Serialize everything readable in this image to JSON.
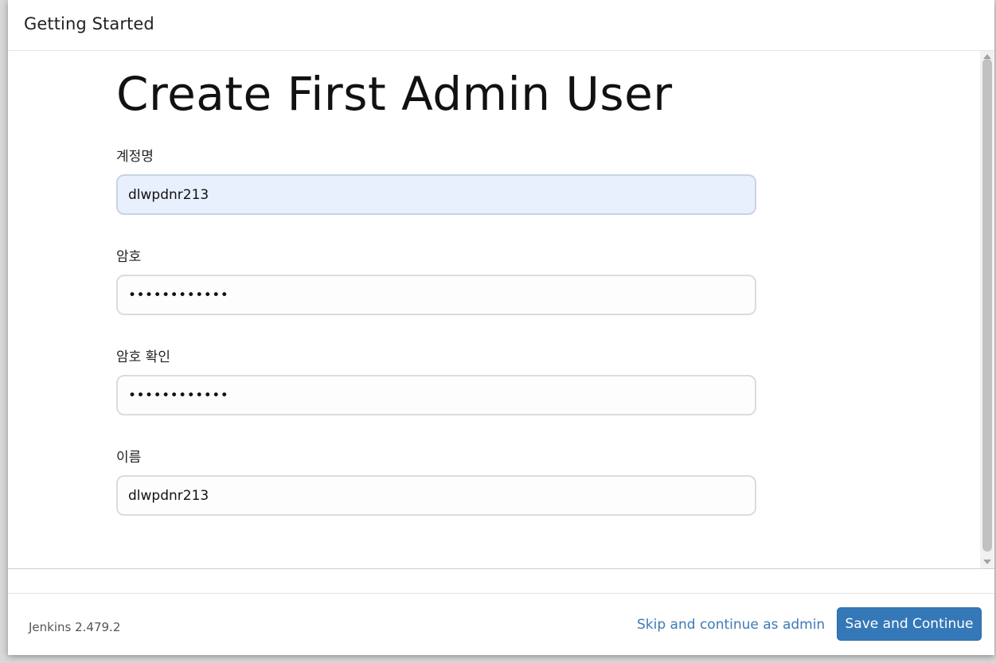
{
  "dialog": {
    "header_title": "Getting Started"
  },
  "page": {
    "title": "Create First Admin User"
  },
  "form": {
    "username": {
      "label": "계정명",
      "value": "dlwpdnr213"
    },
    "password": {
      "label": "암호",
      "value": "••••••••••••"
    },
    "password_confirm": {
      "label": "암호 확인",
      "value": "••••••••••••"
    },
    "fullname": {
      "label": "이름",
      "value": "dlwpdnr213"
    }
  },
  "footer": {
    "version": "Jenkins 2.479.2",
    "skip_label": "Skip and continue as admin",
    "save_label": "Save and Continue"
  },
  "colors": {
    "primary_button": "#3478b8",
    "link": "#3d7ab5",
    "autofill_background": "#e8f0fe"
  }
}
